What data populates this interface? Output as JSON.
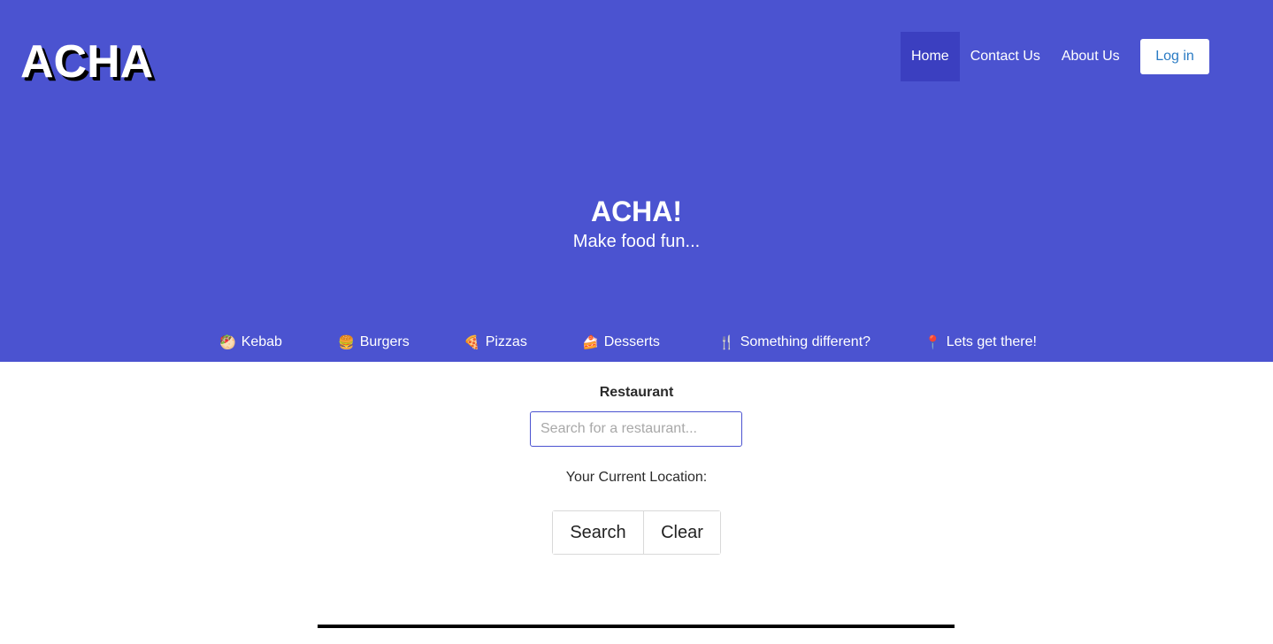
{
  "brand": {
    "logo_text": "ACHA"
  },
  "nav": {
    "items": [
      {
        "label": "Home",
        "active": true
      },
      {
        "label": "Contact Us",
        "active": false
      },
      {
        "label": "About Us",
        "active": false
      }
    ],
    "login_label": "Log in"
  },
  "hero": {
    "title": "ACHA!",
    "subtitle": "Make food fun..."
  },
  "categories": [
    {
      "icon": "kebab-icon",
      "glyph": "🥙",
      "label": "Kebab"
    },
    {
      "icon": "burger-icon",
      "glyph": "🍔",
      "label": "Burgers"
    },
    {
      "icon": "pizza-icon",
      "glyph": "🍕",
      "label": "Pizzas"
    },
    {
      "icon": "cake-icon",
      "glyph": "🍰",
      "label": "Desserts"
    },
    {
      "icon": "fork-knife-icon",
      "glyph": "🍴",
      "label": "Something different?"
    },
    {
      "icon": "location-pin-icon",
      "glyph": "📍",
      "label": "Lets get there!"
    }
  ],
  "search": {
    "label": "Restaurant",
    "placeholder": "Search for a restaurant...",
    "value": "",
    "location_label": "Your Current Location:",
    "search_button": "Search",
    "clear_button": "Clear"
  },
  "colors": {
    "hero_bg": "#4b53d0",
    "nav_active_bg": "#3b3fc0",
    "login_text": "#2a7bc4"
  }
}
